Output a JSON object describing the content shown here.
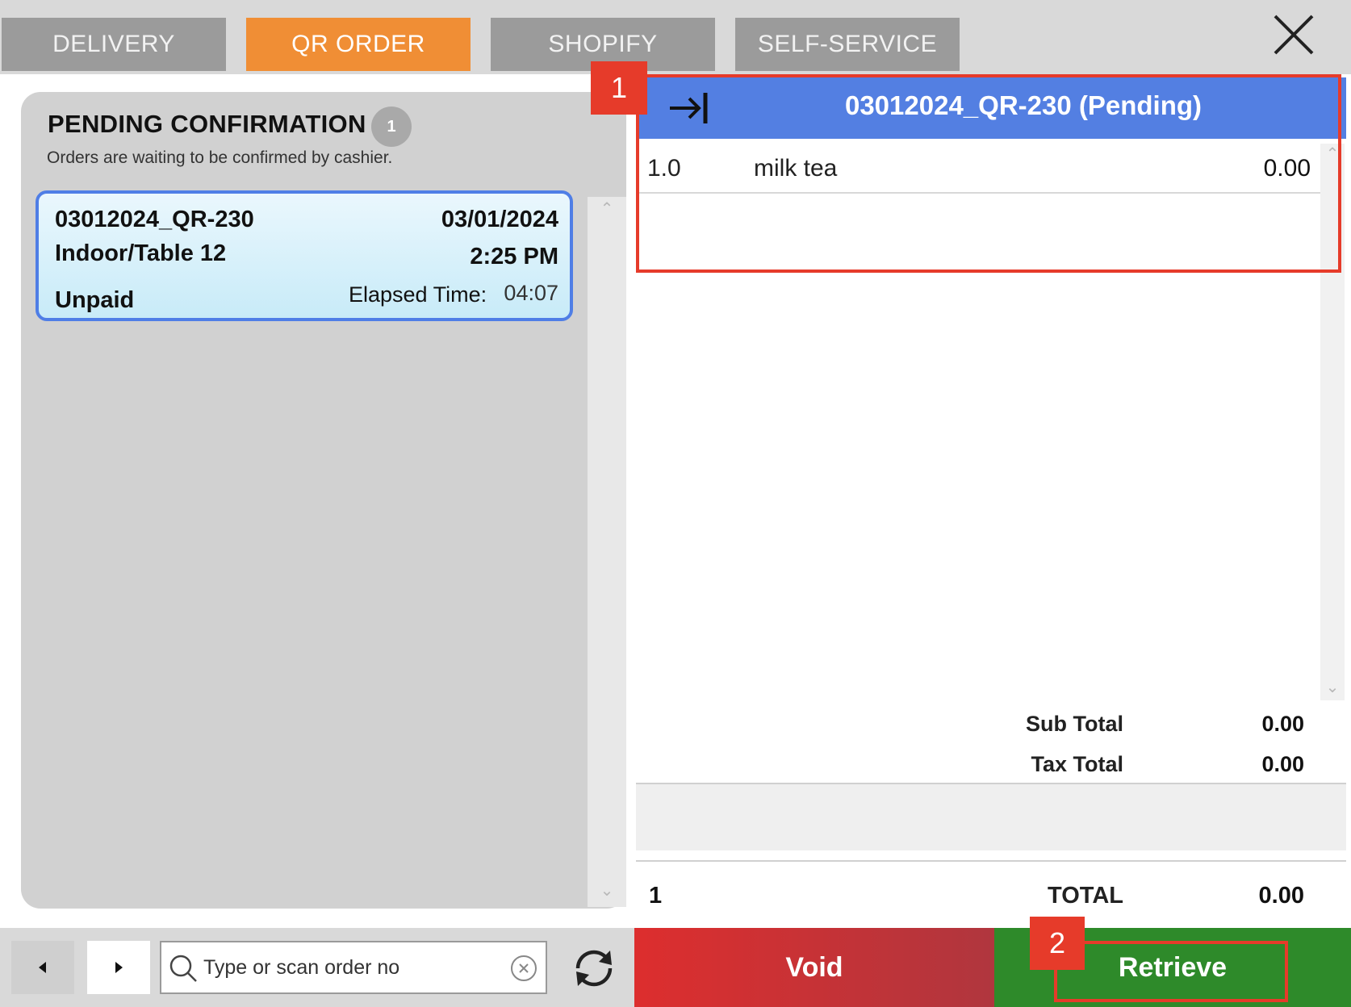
{
  "tabs": [
    {
      "label": "DELIVERY",
      "active": false
    },
    {
      "label": "QR ORDER",
      "active": true
    },
    {
      "label": "SHOPIFY",
      "active": false
    },
    {
      "label": "SELF-SERVICE",
      "active": false
    }
  ],
  "colors": {
    "active_tab": "#f08e35",
    "inactive_tab": "#9b9b9b",
    "order_header": "#537fe2",
    "void": "#dd2e2e",
    "retrieve": "#2e8a2a",
    "annotation": "#e63b2a"
  },
  "pending": {
    "title": "PENDING CONFIRMATION",
    "count": "1",
    "subtitle": "Orders are waiting to be confirmed by cashier."
  },
  "order_card": {
    "order_no": "03012024_QR-230",
    "date": "03/01/2024",
    "table": "Indoor/Table 12",
    "time": "2:25 PM",
    "status": "Unpaid",
    "elapsed_label": "Elapsed Time:",
    "elapsed": "04:07"
  },
  "search": {
    "placeholder": "Type or scan order no"
  },
  "order_detail": {
    "title": "03012024_QR-230 (Pending)",
    "lines": [
      {
        "qty": "1.0",
        "name": "milk tea",
        "price": "0.00"
      }
    ],
    "sub_total_label": "Sub Total",
    "sub_total": "0.00",
    "tax_total_label": "Tax Total",
    "tax_total": "0.00",
    "item_count": "1",
    "total_label": "TOTAL",
    "total": "0.00"
  },
  "actions": {
    "void_label": "Void",
    "retrieve_label": "Retrieve"
  },
  "annotations": {
    "first": "1",
    "second": "2"
  }
}
